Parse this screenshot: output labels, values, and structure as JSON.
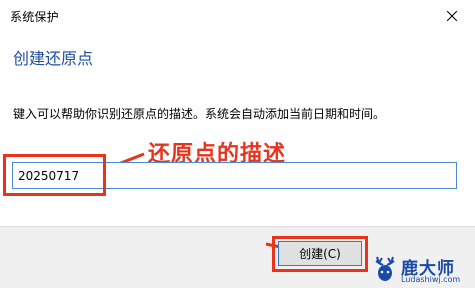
{
  "window": {
    "title": "系统保护",
    "close_icon": "close-icon"
  },
  "dialog": {
    "heading": "创建还原点",
    "description": "键入可以帮助你识别还原点的描述。系统会自动添加当前日期和时间。",
    "input_value": "20250717",
    "create_button_label": "创建(C)"
  },
  "annotation": {
    "label": "还原点的描述",
    "color": "#e8341c"
  },
  "watermark": {
    "name": "鹿大师",
    "url": "Ludashiwj.com",
    "icon": "deer-logo-icon"
  },
  "colors": {
    "accent": "#1e4f9c",
    "focus_border": "#4a8ad8",
    "highlight": "#e8341c"
  }
}
